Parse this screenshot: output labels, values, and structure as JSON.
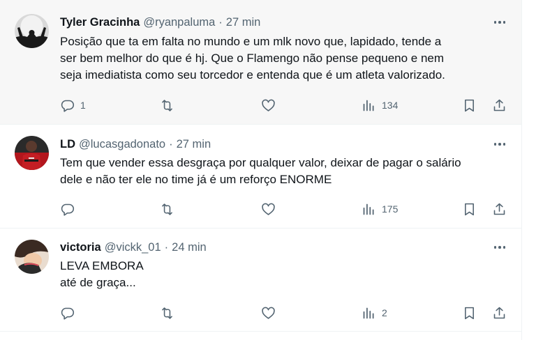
{
  "tweets": [
    {
      "name": "Tyler Gracinha",
      "handle": "@ryanpaluma",
      "separator": "·",
      "time": "27 min",
      "lines": [
        "Posição que ta em falta no mundo e um mlk novo que, lapidado, tende a",
        "ser bem melhor do que é hj. Que o Flamengo não pense pequeno e nem",
        "seja imediatista como seu torcedor e entenda que é um atleta valorizado."
      ],
      "replies": "1",
      "reposts": "",
      "likes": "",
      "views": "134"
    },
    {
      "name": "LD",
      "handle": "@lucasgadonato",
      "separator": "·",
      "time": "27 min",
      "lines": [
        "Tem que vender essa desgraça por qualquer valor, deixar de pagar o salário",
        "dele e não ter ele no time já é um reforço ENORME"
      ],
      "replies": "",
      "reposts": "",
      "likes": "",
      "views": "175"
    },
    {
      "name": "victoria",
      "handle": "@vickk_01",
      "separator": "·",
      "time": "24 min",
      "lines": [
        "LEVA EMBORA",
        "até de graça..."
      ],
      "replies": "",
      "reposts": "",
      "likes": "",
      "views": "2"
    }
  ],
  "icons": {
    "reply": "reply-icon",
    "repost": "repost-icon",
    "like": "like-icon",
    "views": "views-icon",
    "bookmark": "bookmark-icon",
    "share": "share-icon",
    "more": "more-icon"
  },
  "colors": {
    "text": "#0f1419",
    "secondary": "#536471",
    "hover_background": "#f7f7f7",
    "divider": "#eff3f4"
  }
}
